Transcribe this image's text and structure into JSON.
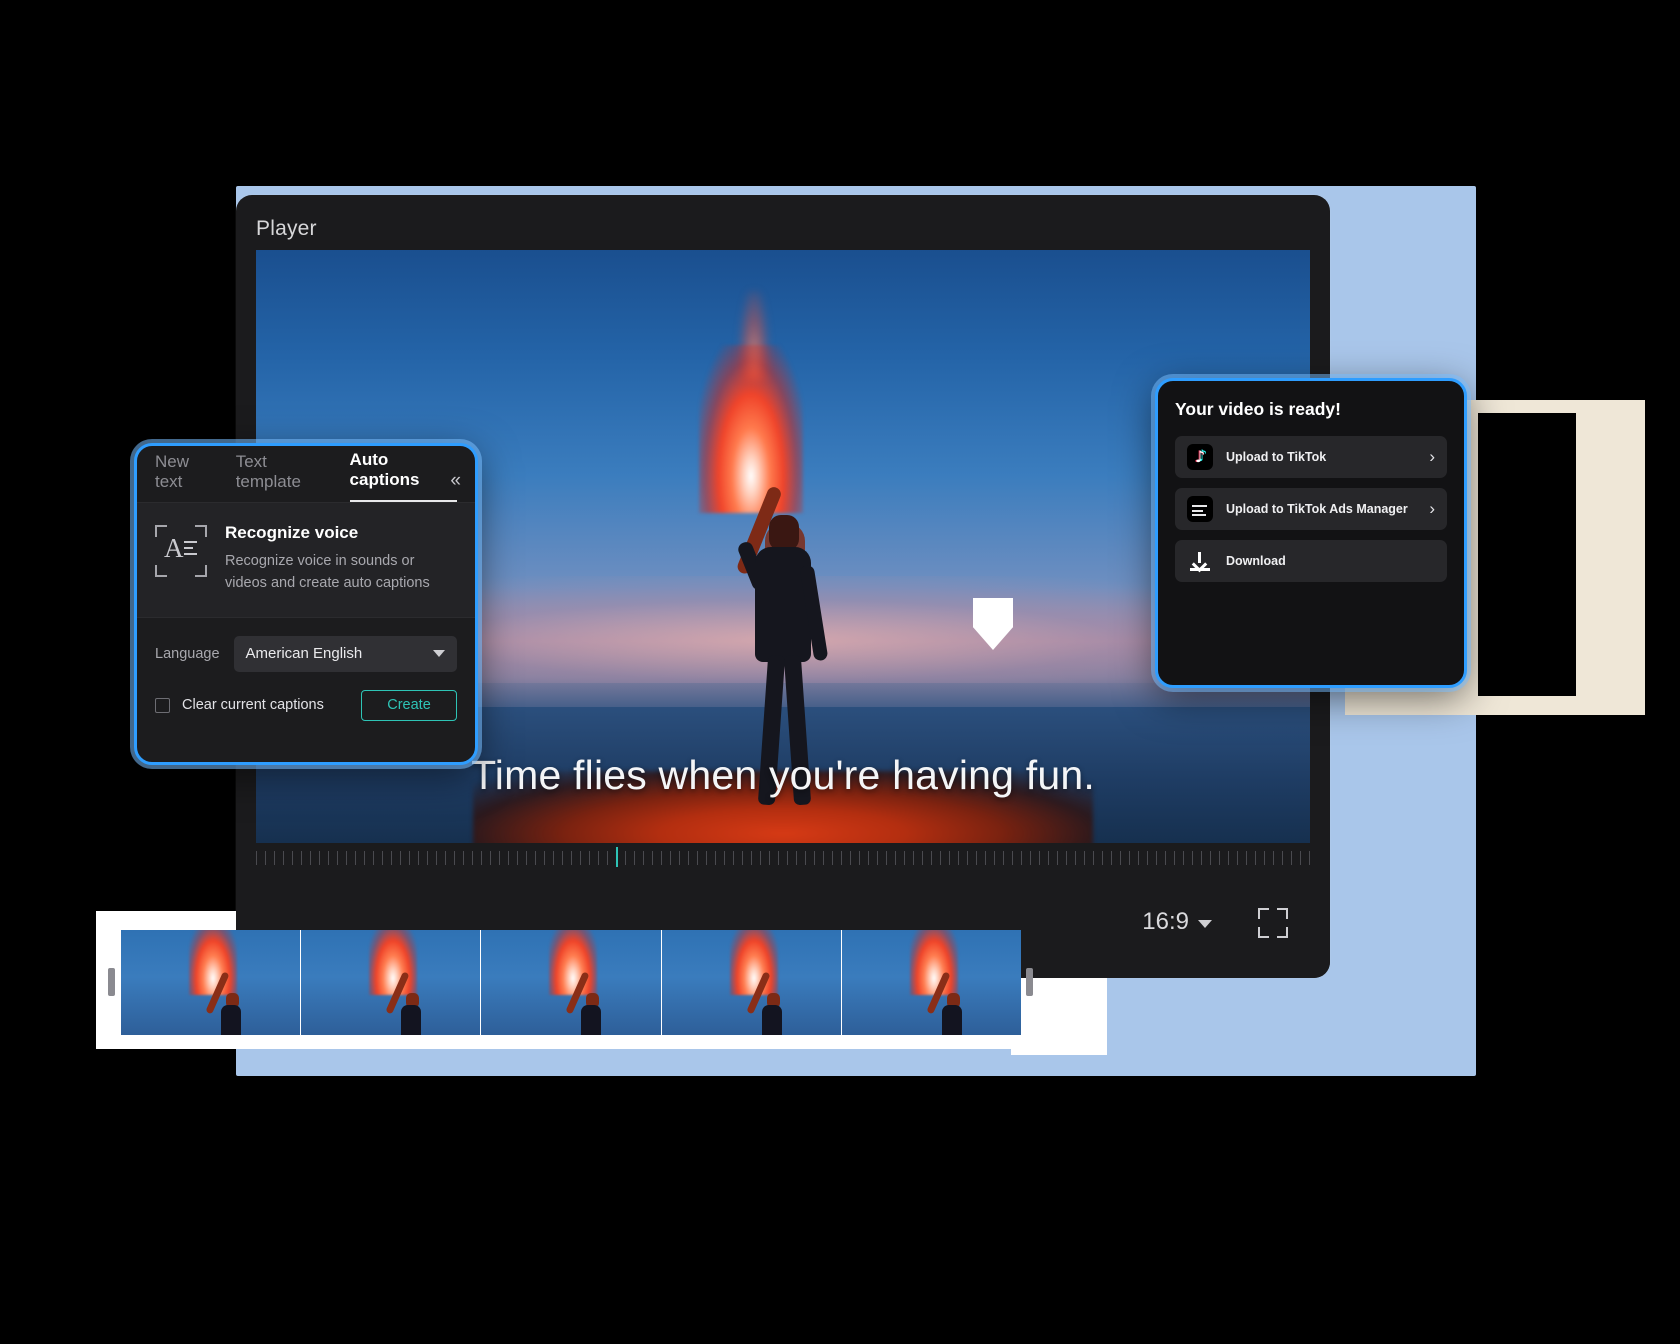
{
  "player": {
    "title": "Player",
    "caption_text": "Time flies when you're having fun.",
    "aspect_ratio": "16:9",
    "aspect_chevron_icon": "chevron-down-icon",
    "fullscreen_icon": "fullscreen-icon",
    "timeline_playhead_icon": "playhead-marker-icon"
  },
  "captions_panel": {
    "tabs": [
      {
        "label": "New text",
        "active": false
      },
      {
        "label": "Text template",
        "active": false
      },
      {
        "label": "Auto captions",
        "active": true
      }
    ],
    "collapse_icon_glyph": "«",
    "recognize": {
      "icon": "recognize-voice-icon",
      "title": "Recognize voice",
      "description": "Recognize voice in sounds or videos and create auto captions"
    },
    "language": {
      "label": "Language",
      "value": "American English",
      "chevron_icon": "chevron-down-icon"
    },
    "clear_captions": {
      "label": "Clear current captions",
      "checked": false
    },
    "create_button": {
      "label": "Create",
      "accent_color": "#2ec4b6"
    }
  },
  "ready_panel": {
    "title": "Your video is ready!",
    "items": [
      {
        "label": "Upload to TikTok",
        "icon": "tiktok-icon",
        "arrow": "›"
      },
      {
        "label": "Upload to TikTok Ads Manager",
        "icon": "tiktok-ads-manager-icon",
        "arrow": "›"
      },
      {
        "label": "Download",
        "icon": "download-icon",
        "arrow": ""
      }
    ]
  },
  "filmstrip": {
    "frame_count": 5,
    "handle_left_icon": "trim-handle-left-icon",
    "handle_right_icon": "trim-handle-right-icon"
  },
  "colors": {
    "accent_blue": "#2e9dff",
    "accent_teal": "#2ec4b6",
    "panel_bg": "#1c1c1e",
    "backdrop_blue": "#a9c6ea",
    "backdrop_cream": "#efe7d7"
  }
}
